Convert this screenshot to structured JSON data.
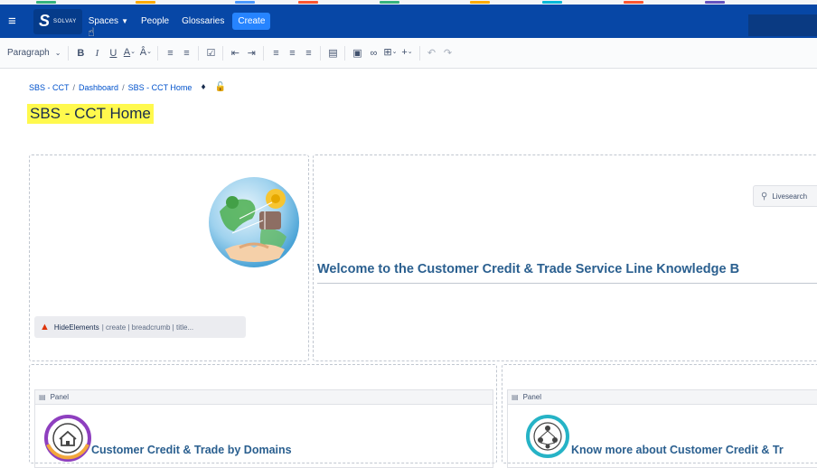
{
  "navbar": {
    "logo_text": "SOLVAY",
    "items": [
      {
        "label": "Spaces",
        "has_dropdown": true
      },
      {
        "label": "People",
        "has_dropdown": false
      },
      {
        "label": "Glossaries",
        "has_dropdown": false
      }
    ],
    "create_label": "Create",
    "background": "#0747a6"
  },
  "toolbar": {
    "paragraph_label": "Paragraph",
    "buttons": [
      "bold",
      "italic",
      "underline",
      "text-color",
      "text-style",
      "bullet-list",
      "numbered-list",
      "task-list",
      "outdent",
      "indent",
      "align-left",
      "align-center",
      "align-right",
      "layout",
      "image",
      "link",
      "table",
      "insert",
      "undo",
      "redo"
    ]
  },
  "breadcrumb": {
    "items": [
      "SBS - CCT",
      "Dashboard",
      "SBS - CCT Home"
    ]
  },
  "page": {
    "title": "SBS - CCT Home",
    "title_highlight": "#fff94d"
  },
  "hide_macro": {
    "name": "HideElements",
    "params": "| create | breadcrumb | title..."
  },
  "livesearch": {
    "placeholder": "Livesearch"
  },
  "welcome": {
    "text": "Welcome to the Customer Credit & Trade Service Line Knowledge B"
  },
  "panels": [
    {
      "header": "Panel",
      "title": "Customer Credit & Trade by Domains"
    },
    {
      "header": "Panel",
      "title": "Know more about Customer Credit & Tr"
    }
  ]
}
